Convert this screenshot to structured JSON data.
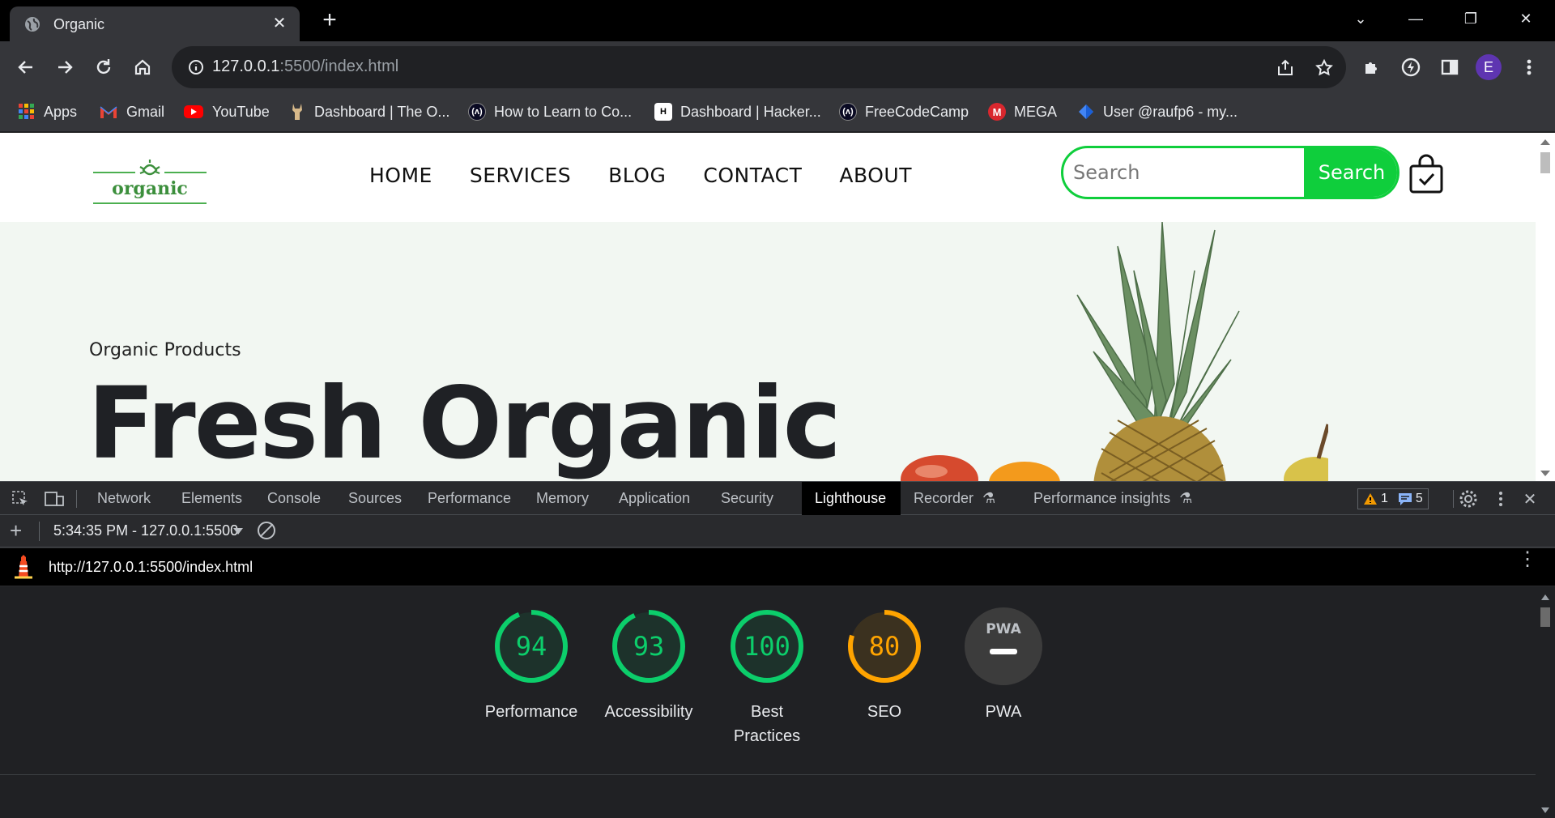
{
  "browser": {
    "tab": {
      "title": "Organic"
    },
    "omnibox": {
      "url_host": "127.0.0.1",
      "url_rest": ":5500/index.html"
    },
    "profile_initial": "E",
    "bookmarks": [
      {
        "label": "Apps",
        "icon": "apps-grid-icon"
      },
      {
        "label": "Gmail",
        "icon": "gmail-icon"
      },
      {
        "label": "YouTube",
        "icon": "youtube-icon"
      },
      {
        "label": "Dashboard | The O...",
        "icon": "odin-icon"
      },
      {
        "label": "How to Learn to Co...",
        "icon": "freecodecamp-icon"
      },
      {
        "label": "Dashboard | Hacker...",
        "icon": "hackerrank-icon"
      },
      {
        "label": "FreeCodeCamp",
        "icon": "freecodecamp-icon"
      },
      {
        "label": "MEGA",
        "icon": "mega-icon"
      },
      {
        "label": "User @raufp6 - my...",
        "icon": "diamond-icon"
      }
    ]
  },
  "site": {
    "logo_text": "organic",
    "nav": [
      "HOME",
      "SERVICES",
      "BLOG",
      "CONTACT",
      "ABOUT"
    ],
    "search": {
      "placeholder": "Search",
      "button": "Search"
    },
    "hero": {
      "kicker": "Organic Products",
      "headline": "Fresh Organic"
    }
  },
  "devtools": {
    "tabs": [
      "Network",
      "Elements",
      "Console",
      "Sources",
      "Performance",
      "Memory",
      "Application",
      "Security",
      "Lighthouse",
      "Recorder",
      "Performance insights"
    ],
    "active_tab": "Lighthouse",
    "warnings_count": "1",
    "messages_count": "5",
    "report_select": "5:34:35 PM - 127.0.0.1:5500",
    "report_url": "http://127.0.0.1:5500/index.html",
    "scores": [
      {
        "label": "Performance",
        "value": "94",
        "color": "#0cce6b"
      },
      {
        "label": "Accessibility",
        "value": "93",
        "color": "#0cce6b"
      },
      {
        "label": "Best Practices",
        "value": "100",
        "color": "#0cce6b"
      },
      {
        "label": "SEO",
        "value": "80",
        "color": "#ffa400"
      }
    ],
    "pwa": {
      "label": "PWA",
      "badge_text": "PWA"
    }
  },
  "colors": {
    "accent_green": "#0fce3c",
    "score_good": "#0cce6b",
    "score_average": "#ffa400"
  }
}
